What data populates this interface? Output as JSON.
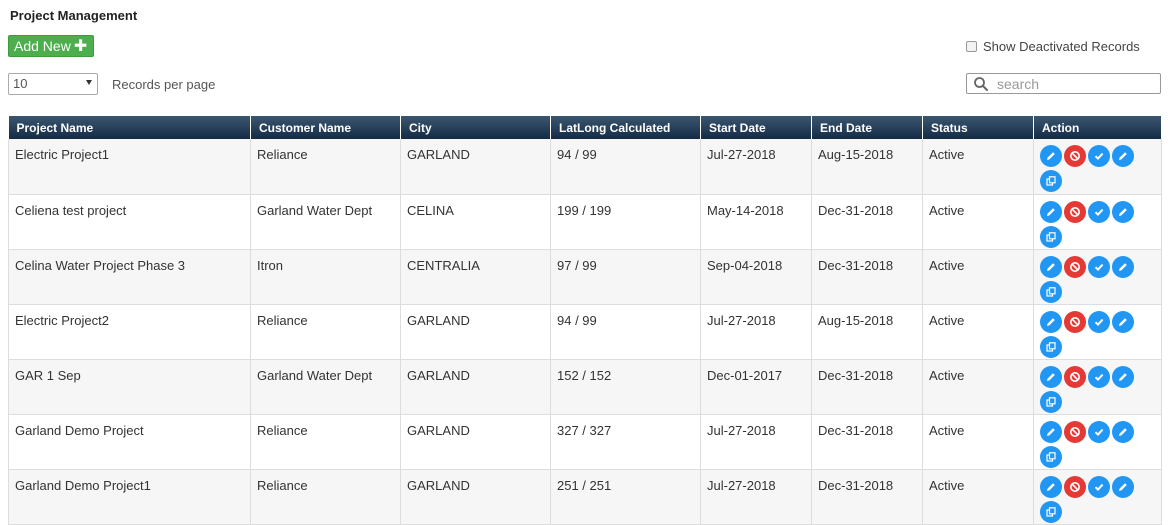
{
  "header": {
    "title": "Project Management",
    "add_new_label": "Add New",
    "show_deactivated_label": "Show Deactivated Records",
    "records_per_page_value": "10",
    "records_per_page_label": "Records per page",
    "search_placeholder": "search"
  },
  "colors": {
    "header_bg": "#152b45",
    "add_button": "#4cae4c",
    "edit_blue": "#2196f3",
    "deactivate_red": "#e53935"
  },
  "table": {
    "columns": [
      "Project Name",
      "Customer Name",
      "City",
      "LatLong Calculated",
      "Start Date",
      "End Date",
      "Status",
      "Action"
    ],
    "rows": [
      {
        "project": "Electric Project1",
        "customer": "Reliance",
        "city": "GARLAND",
        "latlong": "94 / 99",
        "start": "Jul-27-2018",
        "end": "Aug-15-2018",
        "status": "Active"
      },
      {
        "project": "Celiena test project",
        "customer": "Garland Water Dept",
        "city": "CELINA",
        "latlong": "199 / 199",
        "start": "May-14-2018",
        "end": "Dec-31-2018",
        "status": "Active"
      },
      {
        "project": "Celina Water Project Phase 3",
        "customer": "Itron",
        "city": "CENTRALIA",
        "latlong": "97 / 99",
        "start": "Sep-04-2018",
        "end": "Dec-31-2018",
        "status": "Active"
      },
      {
        "project": "Electric Project2",
        "customer": "Reliance",
        "city": "GARLAND",
        "latlong": "94 / 99",
        "start": "Jul-27-2018",
        "end": "Aug-15-2018",
        "status": "Active"
      },
      {
        "project": "GAR 1 Sep",
        "customer": "Garland Water Dept",
        "city": "GARLAND",
        "latlong": "152 / 152",
        "start": "Dec-01-2017",
        "end": "Dec-31-2018",
        "status": "Active"
      },
      {
        "project": "Garland Demo Project",
        "customer": "Reliance",
        "city": "GARLAND",
        "latlong": "327 / 327",
        "start": "Jul-27-2018",
        "end": "Dec-31-2018",
        "status": "Active"
      },
      {
        "project": "Garland Demo Project1",
        "customer": "Reliance",
        "city": "GARLAND",
        "latlong": "251 / 251",
        "start": "Jul-27-2018",
        "end": "Dec-31-2018",
        "status": "Active"
      }
    ],
    "action_icons": [
      "edit-icon",
      "deactivate-icon",
      "approve-check-icon",
      "edit-icon",
      "copy-icon"
    ]
  }
}
